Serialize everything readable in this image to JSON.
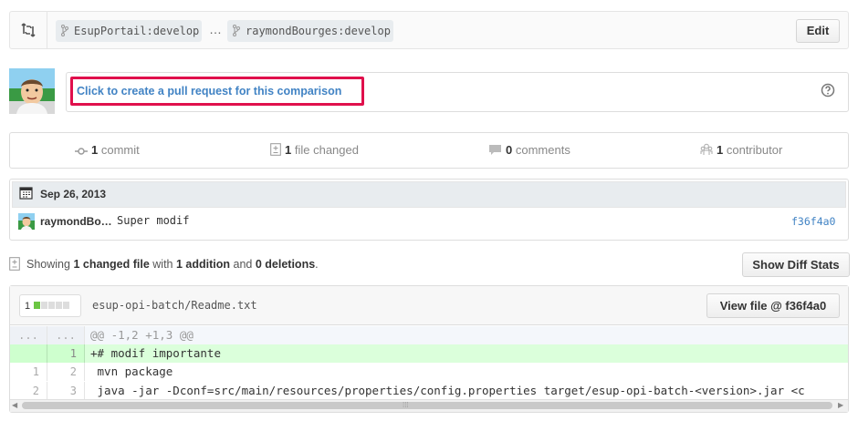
{
  "compare": {
    "base_branch": "EsupPortail:develop",
    "head_branch": "raymondBourges:develop",
    "range_separator": "…",
    "edit_label": "Edit"
  },
  "pull_request": {
    "link_text": "Click to create a pull request for this comparison",
    "help_icon": "question-icon",
    "highlight_color": "#e0104c"
  },
  "stats": {
    "commits_count": "1",
    "commits_label": "commit",
    "files_count": "1",
    "files_label": "file changed",
    "comments_count": "0",
    "comments_label": "comments",
    "contributors_count": "1",
    "contributors_label": "contributor"
  },
  "commits": {
    "date": "Sep 26, 2013",
    "items": [
      {
        "author": "raymondBo…",
        "message": "Super modif",
        "sha": "f36f4a0"
      }
    ]
  },
  "toc": {
    "prefix": "Showing",
    "changed": "1 changed file",
    "with": "with",
    "additions": "1 addition",
    "and": "and",
    "deletions": "0 deletions",
    "suffix": ".",
    "show_diff_stats_label": "Show Diff Stats"
  },
  "file": {
    "diff_count": "1",
    "name": "esup-opi-batch/Readme.txt",
    "view_file_label": "View file @ f36f4a0",
    "lines": [
      {
        "old": "...",
        "new": "...",
        "code": "@@ -1,2 +1,3 @@",
        "type": "hunk"
      },
      {
        "old": "",
        "new": "1",
        "code": "+# modif importante",
        "type": "add"
      },
      {
        "old": "1",
        "new": "2",
        "code": " mvn package",
        "type": "context"
      },
      {
        "old": "2",
        "new": "3",
        "code": " java -jar -Dconf=src/main/resources/properties/config.properties target/esup-opi-batch-<version>.jar <c",
        "type": "context"
      }
    ]
  },
  "colors": {
    "link": "#4183c4",
    "addition": "#dbffdb",
    "addition_gutter": "#ceffce",
    "hunk": "#f4f7fb"
  }
}
